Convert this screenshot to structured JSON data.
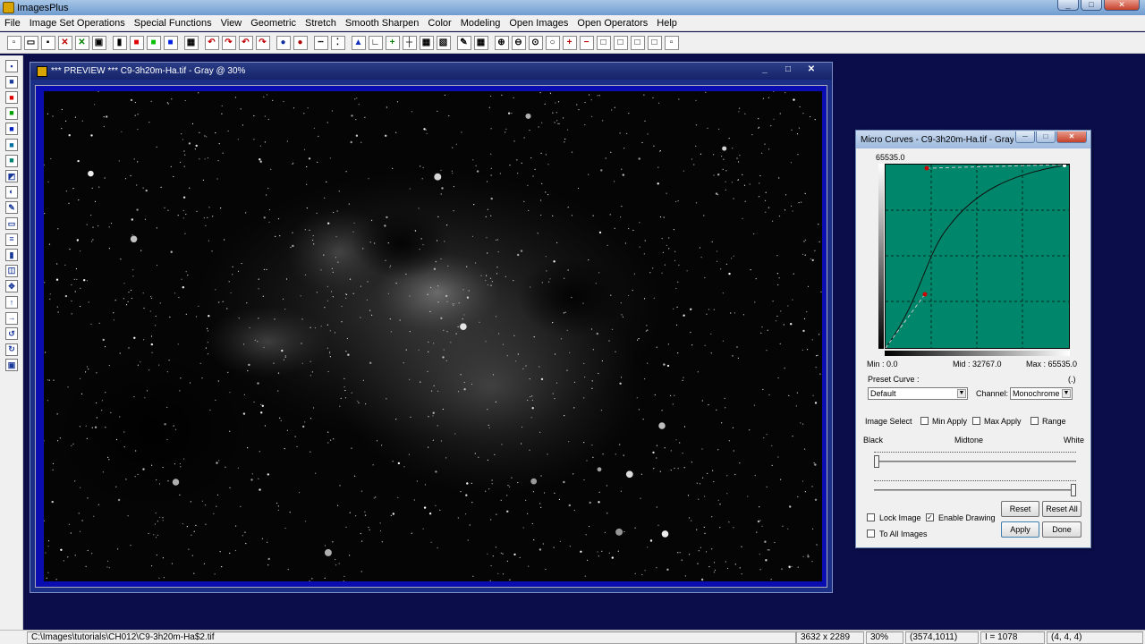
{
  "app": {
    "title": "ImagesPlus"
  },
  "window_controls": {
    "minimize": "_",
    "maximize": "□",
    "close": "✕"
  },
  "menu": [
    "File",
    "Image Set Operations",
    "Special Functions",
    "View",
    "Geometric",
    "Stretch",
    "Smooth Sharpen",
    "Color",
    "Modeling",
    "Open Images",
    "Open Operators",
    "Help"
  ],
  "toolbar_icons": [
    "new-file-icon",
    "open-folder-icon",
    "save-icon",
    "delete-icon",
    "cancel-icon",
    "copy-icon",
    "sep",
    "rgb-channels-icon",
    "red-channel-icon",
    "green-channel-icon",
    "blue-channel-icon",
    "sep",
    "green-grid-icon",
    "sep",
    "undo-icon",
    "redo-icon",
    "undo-all-icon",
    "redo-all-icon",
    "sep",
    "record-icon",
    "stop-record-icon",
    "sep",
    "dotted-line-icon",
    "points-icon",
    "sep",
    "histogram-icon",
    "axis-icon",
    "add-icon",
    "crosshair-icon",
    "grid-icon",
    "image-icon",
    "sep",
    "pencil-icon",
    "table-icon",
    "sep",
    "zoom-in-icon",
    "zoom-out-icon",
    "zoom-fit-icon",
    "zoom-actual-icon",
    "plus-box-icon",
    "minus-box-icon",
    "square-outline-icon",
    "square-small-icon",
    "square-mid-icon",
    "square-tiny-icon",
    "square-dot-icon"
  ],
  "left_toolbar_icons": [
    "save-icon",
    "black-swatch-icon",
    "red-swatch-icon",
    "green-swatch-icon",
    "blue-swatch-icon",
    "cyan-swatch-icon",
    "teal-swatch-icon",
    "black-white-swatch-icon",
    "gradient-icon",
    "pencil-icon",
    "rectangle-icon",
    "levels-icon",
    "black-bar-icon",
    "select-icon",
    "move-icon",
    "up-arrow-icon",
    "right-arrow-icon",
    "rotate-left-icon",
    "rotate-right-icon",
    "frame-icon"
  ],
  "preview": {
    "title": "*** PREVIEW *** C9-3h20m-Ha.tif - Gray @ 30%",
    "controls": {
      "minimize": "_",
      "maximize": "□",
      "close": "✕"
    }
  },
  "dialog": {
    "title": "Micro Curves - C9-3h20m-Ha.tif - Gray...",
    "controls": {
      "minimize": "─",
      "maximize": "□",
      "close": "✕"
    },
    "top_value": "65535.0",
    "min_label": "Min : 0.0",
    "mid_label": "Mid : 32767.0",
    "max_label": "Max : 65535.0",
    "preset_curve_label": "Preset Curve :",
    "preset_value_marker": "(.)",
    "preset_curve_value": "Default",
    "channel_label": "Channel:",
    "channel_value": "Monochrome",
    "image_select_label": "Image Select",
    "min_apply_label": "Min Apply",
    "max_apply_label": "Max Apply",
    "range_label": "Range",
    "black_label": "Black",
    "midtone_label": "Midtone",
    "white_label": "White",
    "lock_image_label": "Lock Image",
    "enable_drawing_label": "Enable Drawing",
    "to_all_images_label": "To All Images",
    "reset_label": "Reset",
    "reset_all_label": "Reset All",
    "apply_label": "Apply",
    "done_label": "Done",
    "checkbox_state": {
      "min_apply": false,
      "max_apply": false,
      "range": false,
      "lock_image": false,
      "enable_drawing": true,
      "to_all_images": false
    },
    "check_mark": "✓",
    "upper_slider_fraction": 0.0,
    "lower_slider_fraction": 1.0
  },
  "status": {
    "path": "C:\\Images\\tutorials\\CH012\\C9-3h20m-Ha$2.tif",
    "dimensions": "3632 x 2289",
    "zoom": "30%",
    "coords": "(3574,1011)",
    "intensity": "I = 1078",
    "rgb": "(4, 4, 4)"
  }
}
